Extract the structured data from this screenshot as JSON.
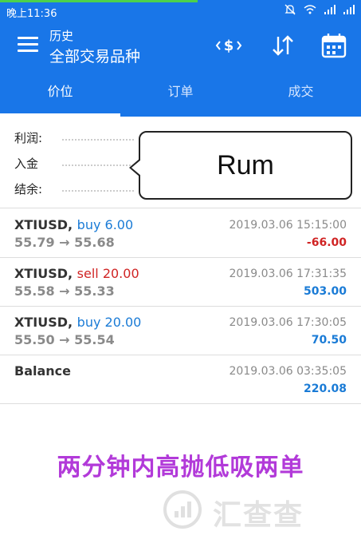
{
  "status_bar": {
    "time": "晚上11:36",
    "icons": [
      "mute-icon",
      "wifi-icon",
      "signal-icon",
      "signal-icon"
    ]
  },
  "app_bar": {
    "title": "历史",
    "subtitle": "全部交易品种",
    "icons": [
      "menu-icon",
      "sort-currency-icon",
      "sort-arrows-icon",
      "calendar-icon"
    ]
  },
  "tabs": [
    {
      "label": "价位",
      "active": true
    },
    {
      "label": "订单",
      "active": false
    },
    {
      "label": "成交",
      "active": false
    }
  ],
  "summary": {
    "profit_label": "利润:",
    "deposit_label": "入金",
    "balance_label": "结余:"
  },
  "popup": {
    "text": "Rum"
  },
  "trades": [
    {
      "symbol": "XTIUSD,",
      "action": "buy 6.00",
      "type": "buy",
      "price": "55.79 → 55.68",
      "date": "2019.03.06 15:15:00",
      "profit": "-66.00"
    },
    {
      "symbol": "XTIUSD,",
      "action": "sell 20.00",
      "type": "sell",
      "price": "55.58 → 55.33",
      "date": "2019.03.06 17:31:35",
      "profit": "503.00"
    },
    {
      "symbol": "XTIUSD,",
      "action": "buy 20.00",
      "type": "buy",
      "price": "55.50 → 55.54",
      "date": "2019.03.06 17:30:05",
      "profit": "70.50"
    },
    {
      "symbol": "Balance",
      "action": "",
      "type": "balance",
      "price": "",
      "date": "2019.03.06 03:35:05",
      "profit": "220.08"
    }
  ],
  "promo_text": "两分钟内高抛低吸两单",
  "watermark_text": "汇查查",
  "colors": {
    "accent": "#1976e8",
    "buy": "#1a7bd6",
    "sell": "#d02424",
    "promo": "#b23ad9"
  }
}
